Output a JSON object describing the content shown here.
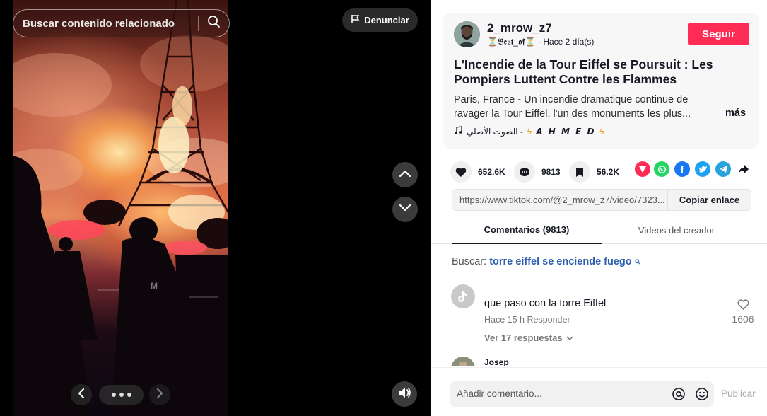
{
  "video": {
    "search_placeholder": "Buscar contenido relacionado",
    "report_label": "Denunciar",
    "icons": {
      "search": "search-icon",
      "report": "flag-icon",
      "prev_video": "chevron-up-icon",
      "next_video": "chevron-down-icon",
      "prev_photo": "chevron-left-icon",
      "next_photo": "chevron-right-icon",
      "volume": "volume-icon"
    },
    "photo_dots": 3
  },
  "author": {
    "username": "2_mrow_z7",
    "nickname": "⏳𝕭𝖊𝖘𝖙_𝖔𝖋⏳",
    "time_ago": "Hace 2 día(s)",
    "follow_label": "Seguir"
  },
  "post": {
    "title": "L'Incendie de la Tour Eiffel se Poursuit : Les Pompiers Luttent Contre les Flammes",
    "description": "Paris, France - Un incendie dramatique continue de ravager la Tour Eiffel, l'un des monuments les plus...",
    "more_label": "más",
    "music": "الصوت الأصلي - ",
    "music_artist": "𝘼 𝙃 𝙈 𝙀 𝘿"
  },
  "stats": {
    "likes": "652.6K",
    "comments": "9813",
    "saves": "56.2K"
  },
  "share": {
    "link": "https://www.tiktok.com/@2_mrow_z7/video/7323...",
    "copy_label": "Copiar enlace",
    "colors": {
      "embed": "#fe2c55",
      "whatsapp": "#25d366",
      "facebook": "#1877f2",
      "twitter": "#1da1f2",
      "telegram": "#2aa3dc"
    }
  },
  "tabs": {
    "comments": "Comentarios (9813)",
    "creator": "Videos del creador"
  },
  "related_search": {
    "label": "Buscar:",
    "query": "torre eiffel se enciende fuego"
  },
  "comments": [
    {
      "text": "que paso con la torre Eiffel",
      "time": "Hace 15 h",
      "reply_label": "Responder",
      "likes": "1606",
      "replies": "Ver 17 respuestas"
    },
    {
      "name": "Josep"
    }
  ],
  "composer": {
    "placeholder": "Añadir comentario...",
    "publish_label": "Publicar"
  },
  "colors": {
    "accent": "#fe2c55",
    "link_blue": "#2b5db1"
  }
}
